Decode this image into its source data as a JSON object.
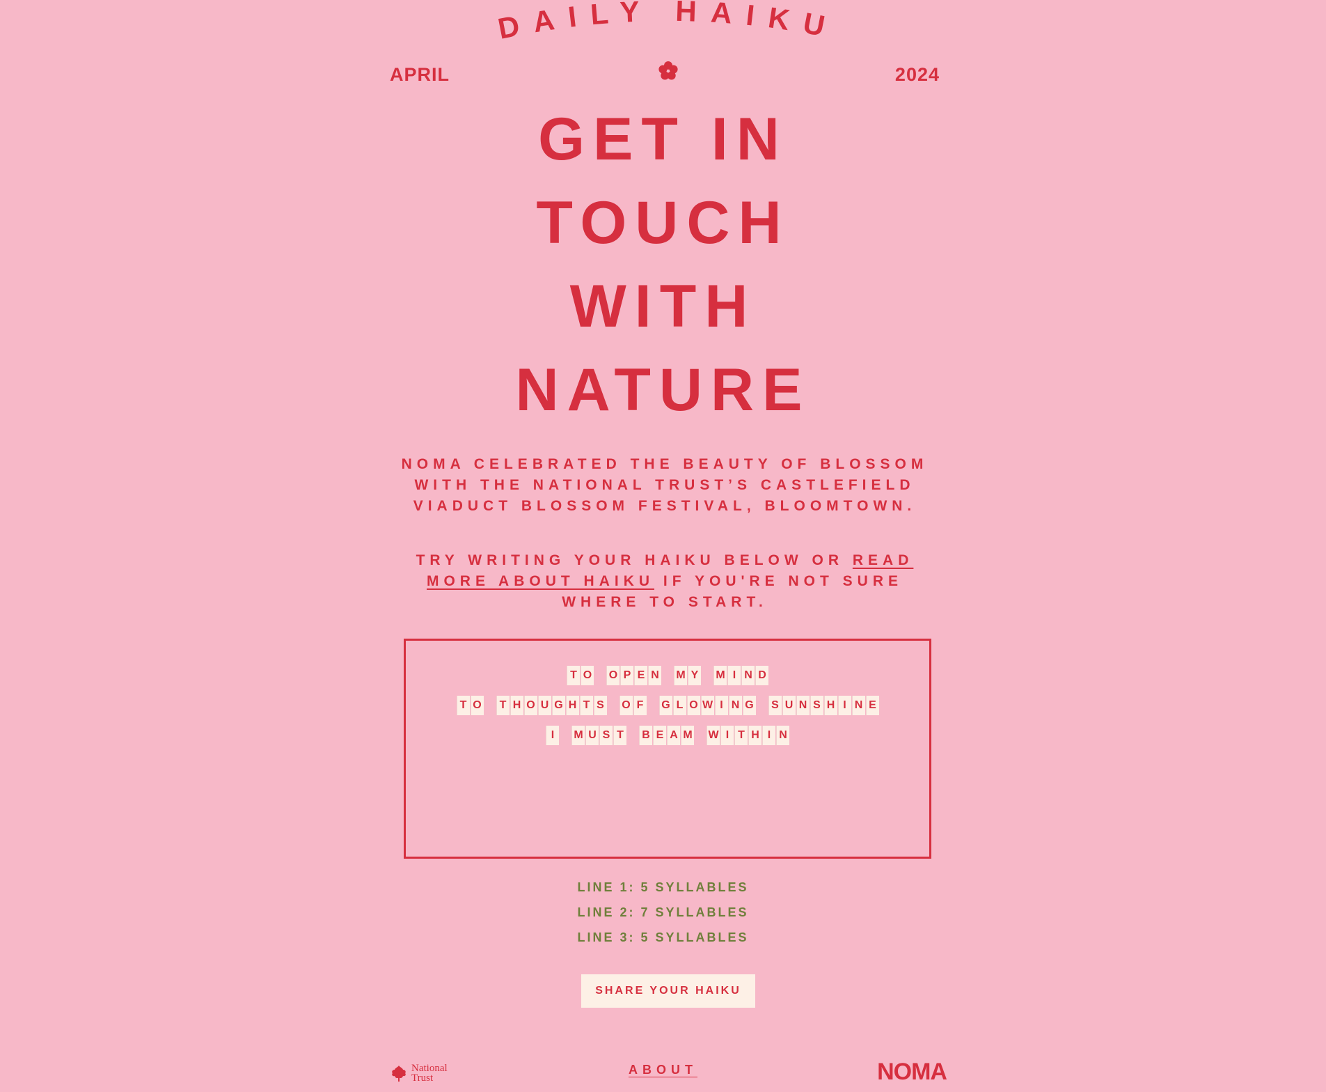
{
  "header": {
    "arch_title": "DAILY HAIKU",
    "month": "APRIL",
    "year": "2024"
  },
  "headline": [
    "GET IN",
    "TOUCH",
    "WITH",
    "NATURE"
  ],
  "intro": "NOMA CELEBRATED THE BEAUTY OF BLOSSOM WITH THE NATIONAL TRUST’S CASTLEFIELD VIADUCT BLOSSOM FESTIVAL, BLOOMTOWN.",
  "prompt": {
    "before": "TRY WRITING YOUR HAIKU BELOW OR ",
    "link": "READ MORE ABOUT HAIKU",
    "after": " IF YOU'RE NOT SURE WHERE TO START."
  },
  "haiku": [
    [
      "TO",
      "OPEN",
      "MY",
      "MIND"
    ],
    [
      "TO",
      "THOUGHTS",
      "OF",
      "GLOWING",
      "SUNSHINE"
    ],
    [
      "I",
      "MUST",
      "BEAM",
      "WITHIN"
    ]
  ],
  "rules": [
    "LINE 1: 5 SYLLABLES",
    "LINE 2: 7 SYLLABLES",
    "LINE 3: 5 SYLLABLES"
  ],
  "share_label": "SHARE YOUR HAIKU",
  "footer": {
    "national_trust": "National\nTrust",
    "about": "ABOUT",
    "noma": "NOMA"
  },
  "colors": {
    "background": "#f7b8c8",
    "accent": "#d62f3f",
    "rules_text": "#6f7f3b",
    "tile": "#fdf0e6"
  },
  "icons": {
    "flower": "flower-icon",
    "oak_leaf": "oak-leaf-icon"
  }
}
